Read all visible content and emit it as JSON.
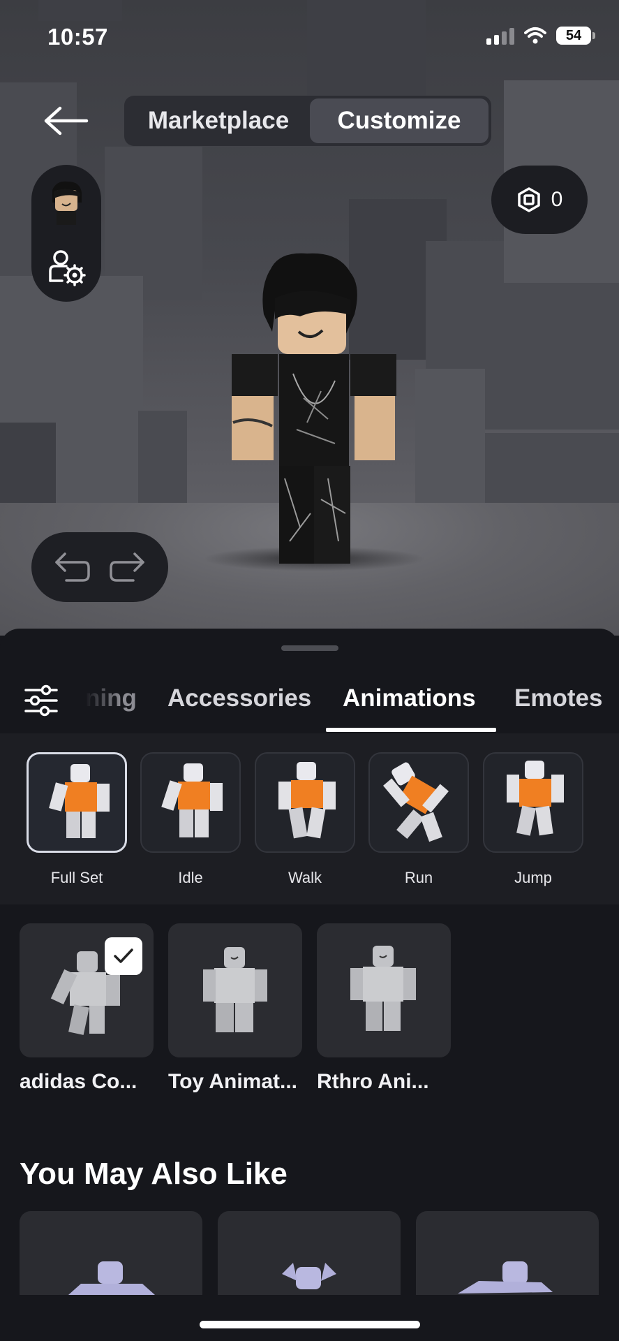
{
  "status_bar": {
    "time": "10:57",
    "battery": "54"
  },
  "header": {
    "tabs": [
      "Marketplace",
      "Customize"
    ],
    "active_tab": "Customize"
  },
  "robux": {
    "balance": "0"
  },
  "category_tabs": [
    "ning",
    "Accessories",
    "Animations",
    "Emotes"
  ],
  "active_category": "Animations",
  "animation_types": [
    "Full Set",
    "Idle",
    "Walk",
    "Run",
    "Jump"
  ],
  "selected_animation_type": "Full Set",
  "owned_items": [
    {
      "name": "adidas Co...",
      "equipped": true
    },
    {
      "name": "Toy Animat...",
      "equipped": false
    },
    {
      "name": "Rthro Ani...",
      "equipped": false
    }
  ],
  "recommendations": {
    "title": "You May Also Like"
  },
  "colors": {
    "sheet_bg": "#16171c",
    "accent_orange": "#f07f22",
    "selected_border": "#d9dce6"
  }
}
